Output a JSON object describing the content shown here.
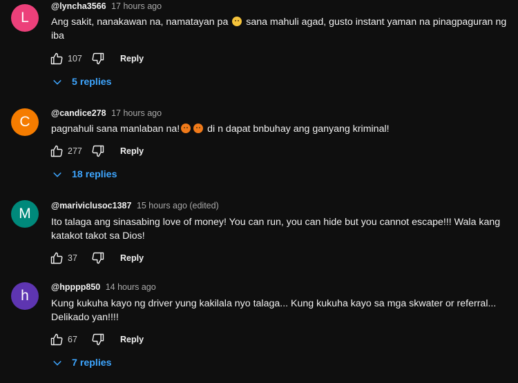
{
  "comments": [
    {
      "avatar_letter": "L",
      "avatar_color": "#ec407a",
      "author": "@lyncha3566",
      "timestamp": "17 hours ago",
      "text_before": "Ang sakit, nanakawan na, namatayan pa ",
      "emoji": "sad-face-emoji",
      "text_after": " sana mahuli agad, gusto instant yaman na pinagpaguran ng iba",
      "likes": "107",
      "reply_label": "Reply",
      "replies_label": "5 replies"
    },
    {
      "avatar_letter": "C",
      "avatar_color": "#f57c00",
      "author": "@candice278",
      "timestamp": "17 hours ago",
      "text_before": "pagnahuli sana manlaban na!",
      "emoji": "angry-face-emoji",
      "text_after": " di n dapat bnbuhay ang ganyang kriminal!",
      "likes": "277",
      "reply_label": "Reply",
      "replies_label": "18 replies"
    },
    {
      "avatar_letter": "M",
      "avatar_color": "#00897b",
      "author": "@mariviclusoc1387",
      "timestamp": "15 hours ago (edited)",
      "text": "Ito talaga ang sinasabing love of money! You can run, you can hide but you cannot escape!!! Wala kang katakot takot sa Dios!",
      "likes": "37",
      "reply_label": "Reply"
    },
    {
      "avatar_letter": "h",
      "avatar_color": "#5e35b1",
      "author": "@hpppp850",
      "timestamp": "14 hours ago",
      "text": "Kung kukuha kayo ng driver yung kakilala nyo talaga... Kung kukuha kayo sa mga skwater or referral... Delikado yan!!!!",
      "likes": "67",
      "reply_label": "Reply",
      "replies_label": "7 replies"
    }
  ],
  "colors": {
    "background": "#0f0f0f",
    "link": "#3ea6ff",
    "secondary_text": "#aaaaaa"
  }
}
